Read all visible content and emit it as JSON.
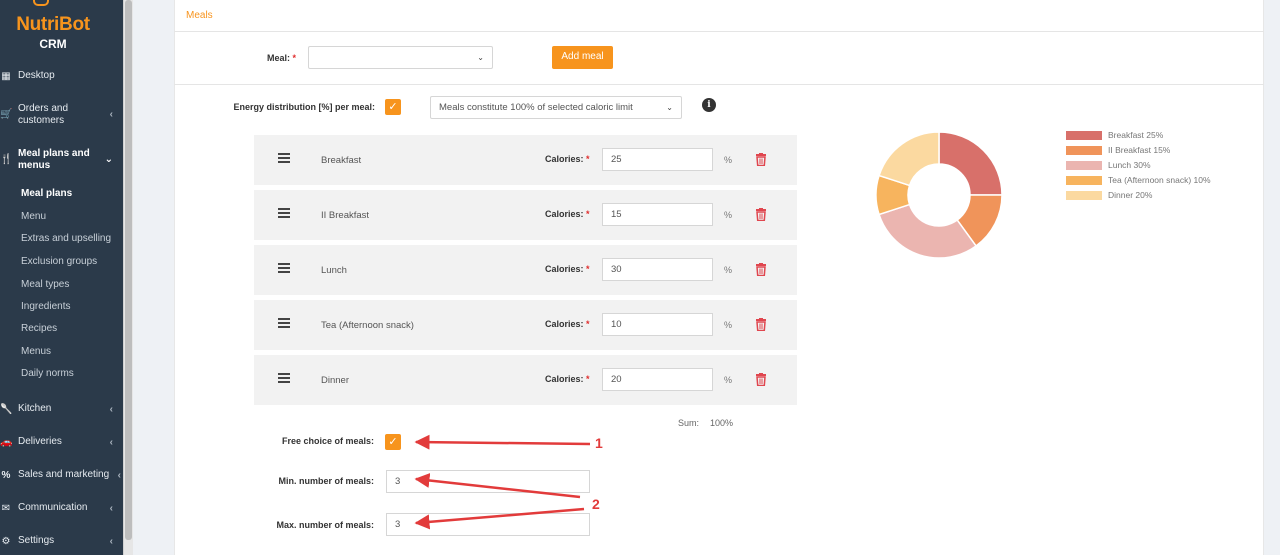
{
  "brand": {
    "name": "NutriBot",
    "sub": "CRM"
  },
  "sidebar": {
    "items": [
      {
        "key": "desktop",
        "label": "Desktop",
        "icon": "grid-icon"
      },
      {
        "key": "orders",
        "label": "Orders and customers",
        "icon": "cart-icon"
      },
      {
        "key": "mealplans",
        "label": "Meal plans and menus",
        "icon": "cutlery-icon"
      },
      {
        "key": "kitchen",
        "label": "Kitchen",
        "icon": "spoon-icon"
      },
      {
        "key": "deliveries",
        "label": "Deliveries",
        "icon": "car-icon"
      },
      {
        "key": "sales",
        "label": "Sales and marketing",
        "icon": "percent-icon"
      },
      {
        "key": "communication",
        "label": "Communication",
        "icon": "envelope-icon"
      },
      {
        "key": "settings",
        "label": "Settings",
        "icon": "gear-icon"
      }
    ],
    "subitems": [
      "Meal plans",
      "Menu",
      "Extras and upselling",
      "Exclusion groups",
      "Meal types",
      "Ingredients",
      "Recipes",
      "Menus",
      "Daily norms"
    ]
  },
  "page": {
    "tab": "Meals",
    "meal_label": "Meal:",
    "required": "*",
    "meal_select_value": "",
    "add_meal": "Add meal",
    "energy_label": "Energy distribution [%] per meal:",
    "energy_select": "Meals constitute 100% of selected caloric limit",
    "calories_label": "Calories:",
    "percent": "%",
    "meals": [
      {
        "name": "Breakfast",
        "value": "25"
      },
      {
        "name": "II Breakfast",
        "value": "15"
      },
      {
        "name": "Lunch",
        "value": "30"
      },
      {
        "name": "Tea (Afternoon snack)",
        "value": "10"
      },
      {
        "name": "Dinner",
        "value": "20"
      }
    ],
    "sum_label": "Sum:",
    "sum_value": "100%",
    "free_choice_label": "Free choice of meals:",
    "min_label": "Min. number of meals:",
    "min_value": "3",
    "max_label": "Max. number of meals:",
    "max_value": "3"
  },
  "annotations": {
    "one": "1",
    "two": "2"
  },
  "chart_data": {
    "type": "pie",
    "categories": [
      "Breakfast",
      "II Breakfast",
      "Lunch",
      "Tea (Afternoon snack)",
      "Dinner"
    ],
    "values": [
      25,
      15,
      30,
      10,
      20
    ],
    "legend": [
      "Breakfast 25%",
      "II Breakfast 15%",
      "Lunch 30%",
      "Tea (Afternoon snack) 10%",
      "Dinner 20%"
    ],
    "colors": [
      "#d8706a",
      "#f0945a",
      "#ebb5b0",
      "#f7b45e",
      "#fbd9a0"
    ],
    "legend_position": "right"
  },
  "colors": {
    "accent": "#f7941d",
    "sidebar": "#2b3a4a",
    "danger": "#e02d2d"
  }
}
